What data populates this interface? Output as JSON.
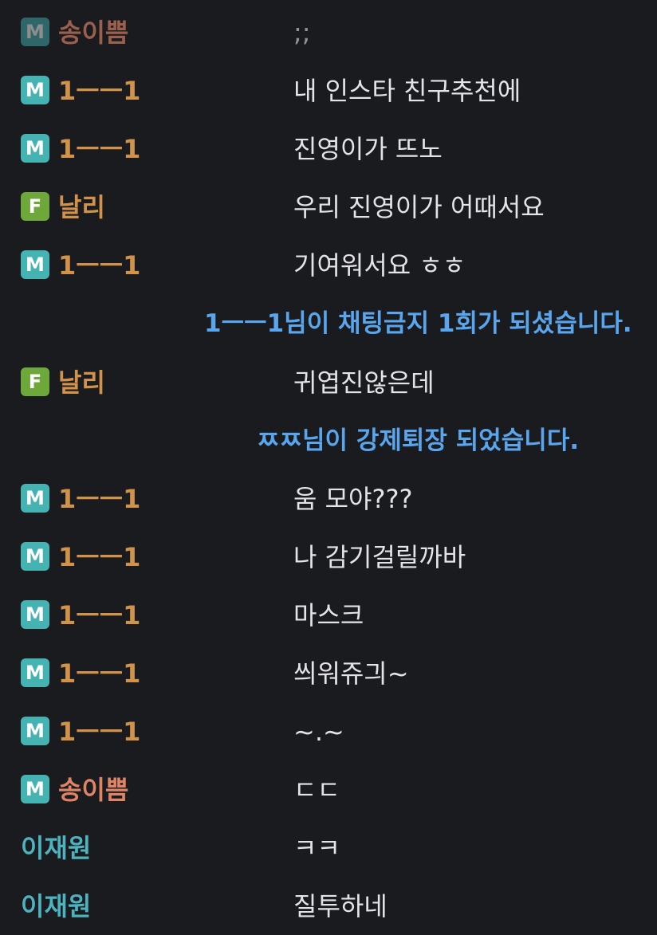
{
  "colors": {
    "background": "#1a1b1f",
    "badge_m": "#45b3b2",
    "badge_f": "#6fa83a",
    "name_orange": "#d1924a",
    "name_salmon": "#e08466",
    "name_teal": "#4cb3bf",
    "system_text": "#5aa6ee",
    "message_text": "#e4e4e6"
  },
  "messages": [
    {
      "type": "chat",
      "badge": "M",
      "name": "송이쁨",
      "name_color": "salmon",
      "text": ";;"
    },
    {
      "type": "chat",
      "badge": "M",
      "name": "1ㅡㅡ1",
      "name_color": "orange",
      "text": "내 인스타 친구추천에"
    },
    {
      "type": "chat",
      "badge": "M",
      "name": "1ㅡㅡ1",
      "name_color": "orange",
      "text": "진영이가 뜨노"
    },
    {
      "type": "chat",
      "badge": "F",
      "name": "날리",
      "name_color": "orange",
      "text": "우리 진영이가 어때서요"
    },
    {
      "type": "chat",
      "badge": "M",
      "name": "1ㅡㅡ1",
      "name_color": "orange",
      "text": "기여워서요 ㅎㅎ"
    },
    {
      "type": "system",
      "text": "1ㅡㅡ1님이 채팅금지 1회가 되셨습니다."
    },
    {
      "type": "chat",
      "badge": "F",
      "name": "날리",
      "name_color": "orange",
      "text": "귀엽진않은데"
    },
    {
      "type": "system",
      "text": "ㅉㅉ님이 강제퇴장 되었습니다."
    },
    {
      "type": "chat",
      "badge": "M",
      "name": "1ㅡㅡ1",
      "name_color": "orange",
      "text": "움 모야???"
    },
    {
      "type": "chat",
      "badge": "M",
      "name": "1ㅡㅡ1",
      "name_color": "orange",
      "text": "나 감기걸릴까바"
    },
    {
      "type": "chat",
      "badge": "M",
      "name": "1ㅡㅡ1",
      "name_color": "orange",
      "text": "마스크"
    },
    {
      "type": "chat",
      "badge": "M",
      "name": "1ㅡㅡ1",
      "name_color": "orange",
      "text": "씌워쥬긔~"
    },
    {
      "type": "chat",
      "badge": "M",
      "name": "1ㅡㅡ1",
      "name_color": "orange",
      "text": "~.~"
    },
    {
      "type": "chat",
      "badge": "M",
      "name": "송이쁨",
      "name_color": "salmon",
      "text": "ㄷㄷ"
    },
    {
      "type": "chat",
      "badge": "",
      "name": "이재원",
      "name_color": "teal",
      "text": "ㅋㅋ"
    },
    {
      "type": "chat",
      "badge": "",
      "name": "이재원",
      "name_color": "teal",
      "text": "질투하네"
    }
  ]
}
